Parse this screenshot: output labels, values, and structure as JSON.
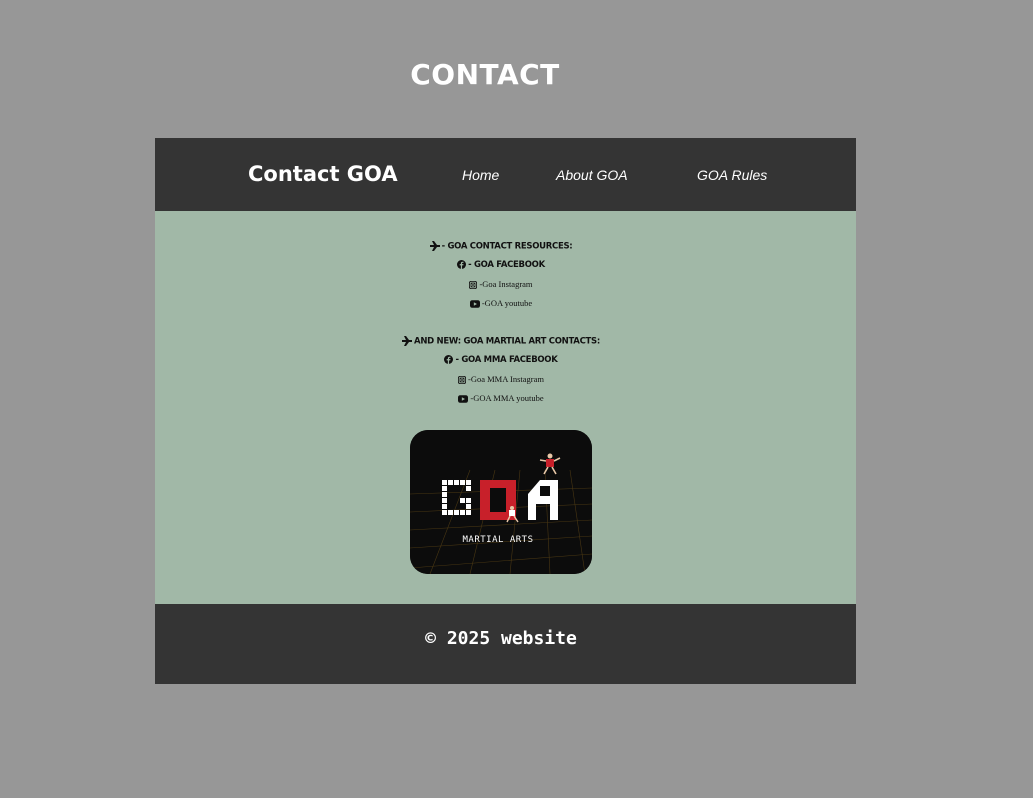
{
  "page": {
    "heading": "CONTACT"
  },
  "nav": {
    "brand": "Contact GOA",
    "links": [
      {
        "label": "Home",
        "icon": "none"
      },
      {
        "label": "About GOA",
        "icon": "none"
      },
      {
        "label": "GOA Rules",
        "icon": "none"
      }
    ]
  },
  "resources": {
    "heading": "- GOA CONTACT RESOURCES:",
    "heading_icon": "plane-icon",
    "links": [
      {
        "label": "- GOA FACEBOOK",
        "icon": "facebook-icon",
        "style": "title"
      },
      {
        "label": "-Goa Instagram",
        "icon": "instagram-icon",
        "style": "sub"
      },
      {
        "label": "-GOA youtube",
        "icon": "youtube-icon",
        "style": "sub"
      }
    ]
  },
  "martial": {
    "heading": "AND NEW: GOA MARTIAL ART CONTACTS:",
    "heading_icon": "plane-icon",
    "links": [
      {
        "label": "- GOA MMA FACEBOOK",
        "icon": "facebook-icon",
        "style": "title"
      },
      {
        "label": "-Goa MMA Instagram",
        "icon": "instagram-icon",
        "style": "sub"
      },
      {
        "label": "-GOA MMA youtube",
        "icon": "youtube-icon",
        "style": "sub"
      }
    ]
  },
  "logo": {
    "caption": "MARTIAL ARTS",
    "letters": "GOA",
    "colors": {
      "accent": "#c8202a",
      "background": "#0c0c0c",
      "grid": "#7a5a1a"
    }
  },
  "footer": {
    "text": "© 2025 website"
  },
  "colors": {
    "page_bg": "#979797",
    "bar_bg": "#343434",
    "content_bg": "#a1b8a7",
    "text_light": "#ffffff"
  }
}
